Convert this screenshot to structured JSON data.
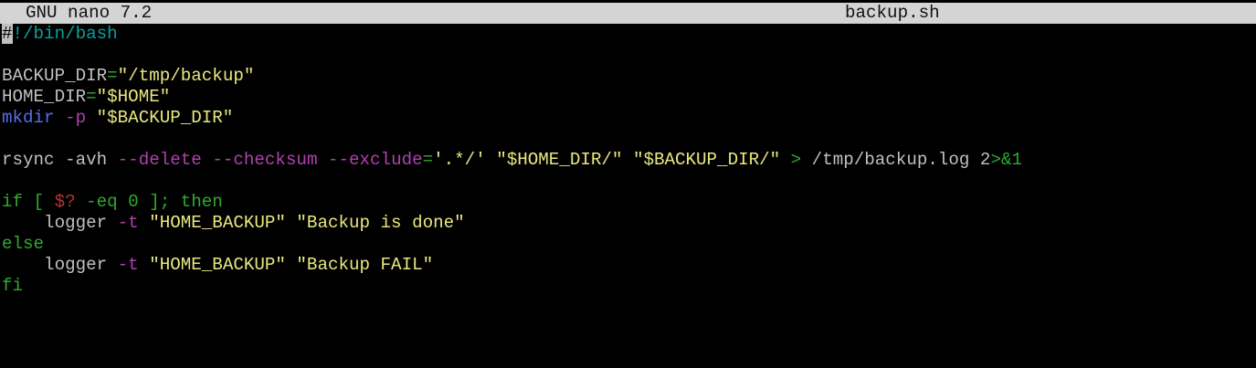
{
  "titlebar": {
    "app": "GNU nano 7.2",
    "filename": "backup.sh"
  },
  "colors": {
    "background": "#000000",
    "titlebar_bg": "#d4d4d4",
    "plain_text": "#c0c0c0",
    "comment": "#0aa0a0",
    "string": "#e8e880",
    "keyword": "#2eaa2e",
    "command": "#5a6ee6",
    "option": "#b040b0",
    "special": "#c03030"
  },
  "editor": {
    "lines": [
      [
        {
          "t": "#",
          "c": "cursor"
        },
        {
          "t": "!/bin/bash",
          "c": "comment"
        }
      ],
      [],
      [
        {
          "t": "BACKUP_DIR",
          "c": "plain"
        },
        {
          "t": "=",
          "c": "eq"
        },
        {
          "t": "\"/tmp/backup\"",
          "c": "string"
        }
      ],
      [
        {
          "t": "HOME_DIR",
          "c": "plain"
        },
        {
          "t": "=",
          "c": "eq"
        },
        {
          "t": "\"$HOME\"",
          "c": "string"
        }
      ],
      [
        {
          "t": "mkdir",
          "c": "cmd"
        },
        {
          "t": " ",
          "c": "plain"
        },
        {
          "t": "-p",
          "c": "flag"
        },
        {
          "t": " \"$BACKUP_DIR\"",
          "c": "string"
        }
      ],
      [],
      [
        {
          "t": "rsync -avh ",
          "c": "plain"
        },
        {
          "t": "--delete",
          "c": "opt"
        },
        {
          "t": " ",
          "c": "plain"
        },
        {
          "t": "--checksum",
          "c": "opt"
        },
        {
          "t": " ",
          "c": "plain"
        },
        {
          "t": "--exclude",
          "c": "opt"
        },
        {
          "t": "=",
          "c": "eq"
        },
        {
          "t": "'.*/'",
          "c": "string"
        },
        {
          "t": " ",
          "c": "plain"
        },
        {
          "t": "\"$HOME_DIR/\"",
          "c": "string"
        },
        {
          "t": " ",
          "c": "plain"
        },
        {
          "t": "\"$BACKUP_DIR/\"",
          "c": "string"
        },
        {
          "t": " ",
          "c": "plain"
        },
        {
          "t": ">",
          "c": "eq"
        },
        {
          "t": " /tmp/backup.log 2",
          "c": "plain"
        },
        {
          "t": ">&1",
          "c": "eq"
        }
      ],
      [],
      [
        {
          "t": "if",
          "c": "kw"
        },
        {
          "t": " [ ",
          "c": "kw"
        },
        {
          "t": "$?",
          "c": "special"
        },
        {
          "t": " -eq 0 ]; ",
          "c": "kw"
        },
        {
          "t": "then",
          "c": "kw"
        }
      ],
      [
        {
          "t": "    logger ",
          "c": "plain"
        },
        {
          "t": "-t",
          "c": "flag"
        },
        {
          "t": " ",
          "c": "plain"
        },
        {
          "t": "\"HOME_BACKUP\"",
          "c": "string"
        },
        {
          "t": " ",
          "c": "plain"
        },
        {
          "t": "\"Backup is done\"",
          "c": "string"
        }
      ],
      [
        {
          "t": "else",
          "c": "kw"
        }
      ],
      [
        {
          "t": "    logger ",
          "c": "plain"
        },
        {
          "t": "-t",
          "c": "flag"
        },
        {
          "t": " ",
          "c": "plain"
        },
        {
          "t": "\"HOME_BACKUP\"",
          "c": "string"
        },
        {
          "t": " ",
          "c": "plain"
        },
        {
          "t": "\"Backup FAIL\"",
          "c": "string"
        }
      ],
      [
        {
          "t": "fi",
          "c": "kw"
        }
      ]
    ]
  }
}
